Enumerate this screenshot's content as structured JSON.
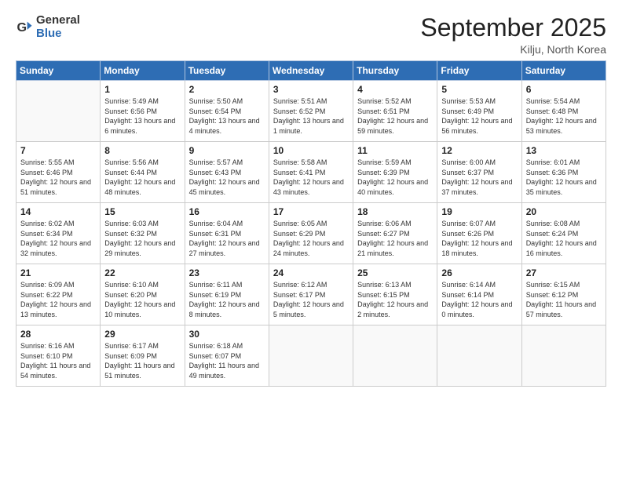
{
  "logo": {
    "text_general": "General",
    "text_blue": "Blue"
  },
  "header": {
    "title": "September 2025",
    "subtitle": "Kilju, North Korea"
  },
  "days_of_week": [
    "Sunday",
    "Monday",
    "Tuesday",
    "Wednesday",
    "Thursday",
    "Friday",
    "Saturday"
  ],
  "weeks": [
    [
      {
        "day": "",
        "sunrise": "",
        "sunset": "",
        "daylight": ""
      },
      {
        "day": "1",
        "sunrise": "Sunrise: 5:49 AM",
        "sunset": "Sunset: 6:56 PM",
        "daylight": "Daylight: 13 hours and 6 minutes."
      },
      {
        "day": "2",
        "sunrise": "Sunrise: 5:50 AM",
        "sunset": "Sunset: 6:54 PM",
        "daylight": "Daylight: 13 hours and 4 minutes."
      },
      {
        "day": "3",
        "sunrise": "Sunrise: 5:51 AM",
        "sunset": "Sunset: 6:52 PM",
        "daylight": "Daylight: 13 hours and 1 minute."
      },
      {
        "day": "4",
        "sunrise": "Sunrise: 5:52 AM",
        "sunset": "Sunset: 6:51 PM",
        "daylight": "Daylight: 12 hours and 59 minutes."
      },
      {
        "day": "5",
        "sunrise": "Sunrise: 5:53 AM",
        "sunset": "Sunset: 6:49 PM",
        "daylight": "Daylight: 12 hours and 56 minutes."
      },
      {
        "day": "6",
        "sunrise": "Sunrise: 5:54 AM",
        "sunset": "Sunset: 6:48 PM",
        "daylight": "Daylight: 12 hours and 53 minutes."
      }
    ],
    [
      {
        "day": "7",
        "sunrise": "Sunrise: 5:55 AM",
        "sunset": "Sunset: 6:46 PM",
        "daylight": "Daylight: 12 hours and 51 minutes."
      },
      {
        "day": "8",
        "sunrise": "Sunrise: 5:56 AM",
        "sunset": "Sunset: 6:44 PM",
        "daylight": "Daylight: 12 hours and 48 minutes."
      },
      {
        "day": "9",
        "sunrise": "Sunrise: 5:57 AM",
        "sunset": "Sunset: 6:43 PM",
        "daylight": "Daylight: 12 hours and 45 minutes."
      },
      {
        "day": "10",
        "sunrise": "Sunrise: 5:58 AM",
        "sunset": "Sunset: 6:41 PM",
        "daylight": "Daylight: 12 hours and 43 minutes."
      },
      {
        "day": "11",
        "sunrise": "Sunrise: 5:59 AM",
        "sunset": "Sunset: 6:39 PM",
        "daylight": "Daylight: 12 hours and 40 minutes."
      },
      {
        "day": "12",
        "sunrise": "Sunrise: 6:00 AM",
        "sunset": "Sunset: 6:37 PM",
        "daylight": "Daylight: 12 hours and 37 minutes."
      },
      {
        "day": "13",
        "sunrise": "Sunrise: 6:01 AM",
        "sunset": "Sunset: 6:36 PM",
        "daylight": "Daylight: 12 hours and 35 minutes."
      }
    ],
    [
      {
        "day": "14",
        "sunrise": "Sunrise: 6:02 AM",
        "sunset": "Sunset: 6:34 PM",
        "daylight": "Daylight: 12 hours and 32 minutes."
      },
      {
        "day": "15",
        "sunrise": "Sunrise: 6:03 AM",
        "sunset": "Sunset: 6:32 PM",
        "daylight": "Daylight: 12 hours and 29 minutes."
      },
      {
        "day": "16",
        "sunrise": "Sunrise: 6:04 AM",
        "sunset": "Sunset: 6:31 PM",
        "daylight": "Daylight: 12 hours and 27 minutes."
      },
      {
        "day": "17",
        "sunrise": "Sunrise: 6:05 AM",
        "sunset": "Sunset: 6:29 PM",
        "daylight": "Daylight: 12 hours and 24 minutes."
      },
      {
        "day": "18",
        "sunrise": "Sunrise: 6:06 AM",
        "sunset": "Sunset: 6:27 PM",
        "daylight": "Daylight: 12 hours and 21 minutes."
      },
      {
        "day": "19",
        "sunrise": "Sunrise: 6:07 AM",
        "sunset": "Sunset: 6:26 PM",
        "daylight": "Daylight: 12 hours and 18 minutes."
      },
      {
        "day": "20",
        "sunrise": "Sunrise: 6:08 AM",
        "sunset": "Sunset: 6:24 PM",
        "daylight": "Daylight: 12 hours and 16 minutes."
      }
    ],
    [
      {
        "day": "21",
        "sunrise": "Sunrise: 6:09 AM",
        "sunset": "Sunset: 6:22 PM",
        "daylight": "Daylight: 12 hours and 13 minutes."
      },
      {
        "day": "22",
        "sunrise": "Sunrise: 6:10 AM",
        "sunset": "Sunset: 6:20 PM",
        "daylight": "Daylight: 12 hours and 10 minutes."
      },
      {
        "day": "23",
        "sunrise": "Sunrise: 6:11 AM",
        "sunset": "Sunset: 6:19 PM",
        "daylight": "Daylight: 12 hours and 8 minutes."
      },
      {
        "day": "24",
        "sunrise": "Sunrise: 6:12 AM",
        "sunset": "Sunset: 6:17 PM",
        "daylight": "Daylight: 12 hours and 5 minutes."
      },
      {
        "day": "25",
        "sunrise": "Sunrise: 6:13 AM",
        "sunset": "Sunset: 6:15 PM",
        "daylight": "Daylight: 12 hours and 2 minutes."
      },
      {
        "day": "26",
        "sunrise": "Sunrise: 6:14 AM",
        "sunset": "Sunset: 6:14 PM",
        "daylight": "Daylight: 12 hours and 0 minutes."
      },
      {
        "day": "27",
        "sunrise": "Sunrise: 6:15 AM",
        "sunset": "Sunset: 6:12 PM",
        "daylight": "Daylight: 11 hours and 57 minutes."
      }
    ],
    [
      {
        "day": "28",
        "sunrise": "Sunrise: 6:16 AM",
        "sunset": "Sunset: 6:10 PM",
        "daylight": "Daylight: 11 hours and 54 minutes."
      },
      {
        "day": "29",
        "sunrise": "Sunrise: 6:17 AM",
        "sunset": "Sunset: 6:09 PM",
        "daylight": "Daylight: 11 hours and 51 minutes."
      },
      {
        "day": "30",
        "sunrise": "Sunrise: 6:18 AM",
        "sunset": "Sunset: 6:07 PM",
        "daylight": "Daylight: 11 hours and 49 minutes."
      },
      {
        "day": "",
        "sunrise": "",
        "sunset": "",
        "daylight": ""
      },
      {
        "day": "",
        "sunrise": "",
        "sunset": "",
        "daylight": ""
      },
      {
        "day": "",
        "sunrise": "",
        "sunset": "",
        "daylight": ""
      },
      {
        "day": "",
        "sunrise": "",
        "sunset": "",
        "daylight": ""
      }
    ]
  ]
}
